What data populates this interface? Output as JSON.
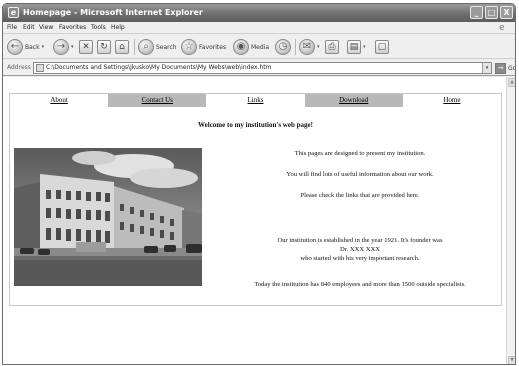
{
  "window": {
    "title": "Homepage - Microsoft Internet Explorer",
    "controls": {
      "minimize": "_",
      "maximize": "□",
      "close": "X"
    }
  },
  "menu": {
    "items": [
      "File",
      "Edit",
      "View",
      "Favorites",
      "Tools",
      "Help"
    ]
  },
  "toolbar": {
    "back": "Back",
    "search": "Search",
    "favorites": "Favorites",
    "media": "Media"
  },
  "address": {
    "label": "Address",
    "value": "C:\\Documents and Settings\\jkusko\\My Documents\\My Webs\\web\\index.htm",
    "go": "Go"
  },
  "page": {
    "nav": [
      "About",
      "Contact Us",
      "Links",
      "Download",
      "Home"
    ],
    "welcome": "Welcome to my institution's web page!",
    "paragraphs": [
      "This pages are designed to present my institution.",
      "You will find lots of useful information about our work.",
      "Please check the links that are provided here.",
      "Our institution is established in the year 1921. It's founder was",
      "Dr. XXX XXX",
      "who started with his very important research.",
      "Today the institution has 840 employees and more than 1500 outside specialists."
    ]
  },
  "icons": {
    "ie_logo": "e",
    "back": "←",
    "forward": "→",
    "stop": "✕",
    "refresh": "↻",
    "home": "⌂",
    "search": "⌕",
    "favorites": "☆",
    "media": "◉",
    "history": "◷",
    "mail": "✉",
    "print": "⎙",
    "edit": "▤",
    "discuss": "▢",
    "dropdown": "▾",
    "go": "→",
    "scroll_up": "▲",
    "scroll_down": "▼"
  },
  "colors": {
    "titlebar": "#6f6f6f",
    "nav_highlight": "#b8b8b8",
    "chrome": "#efefef"
  }
}
